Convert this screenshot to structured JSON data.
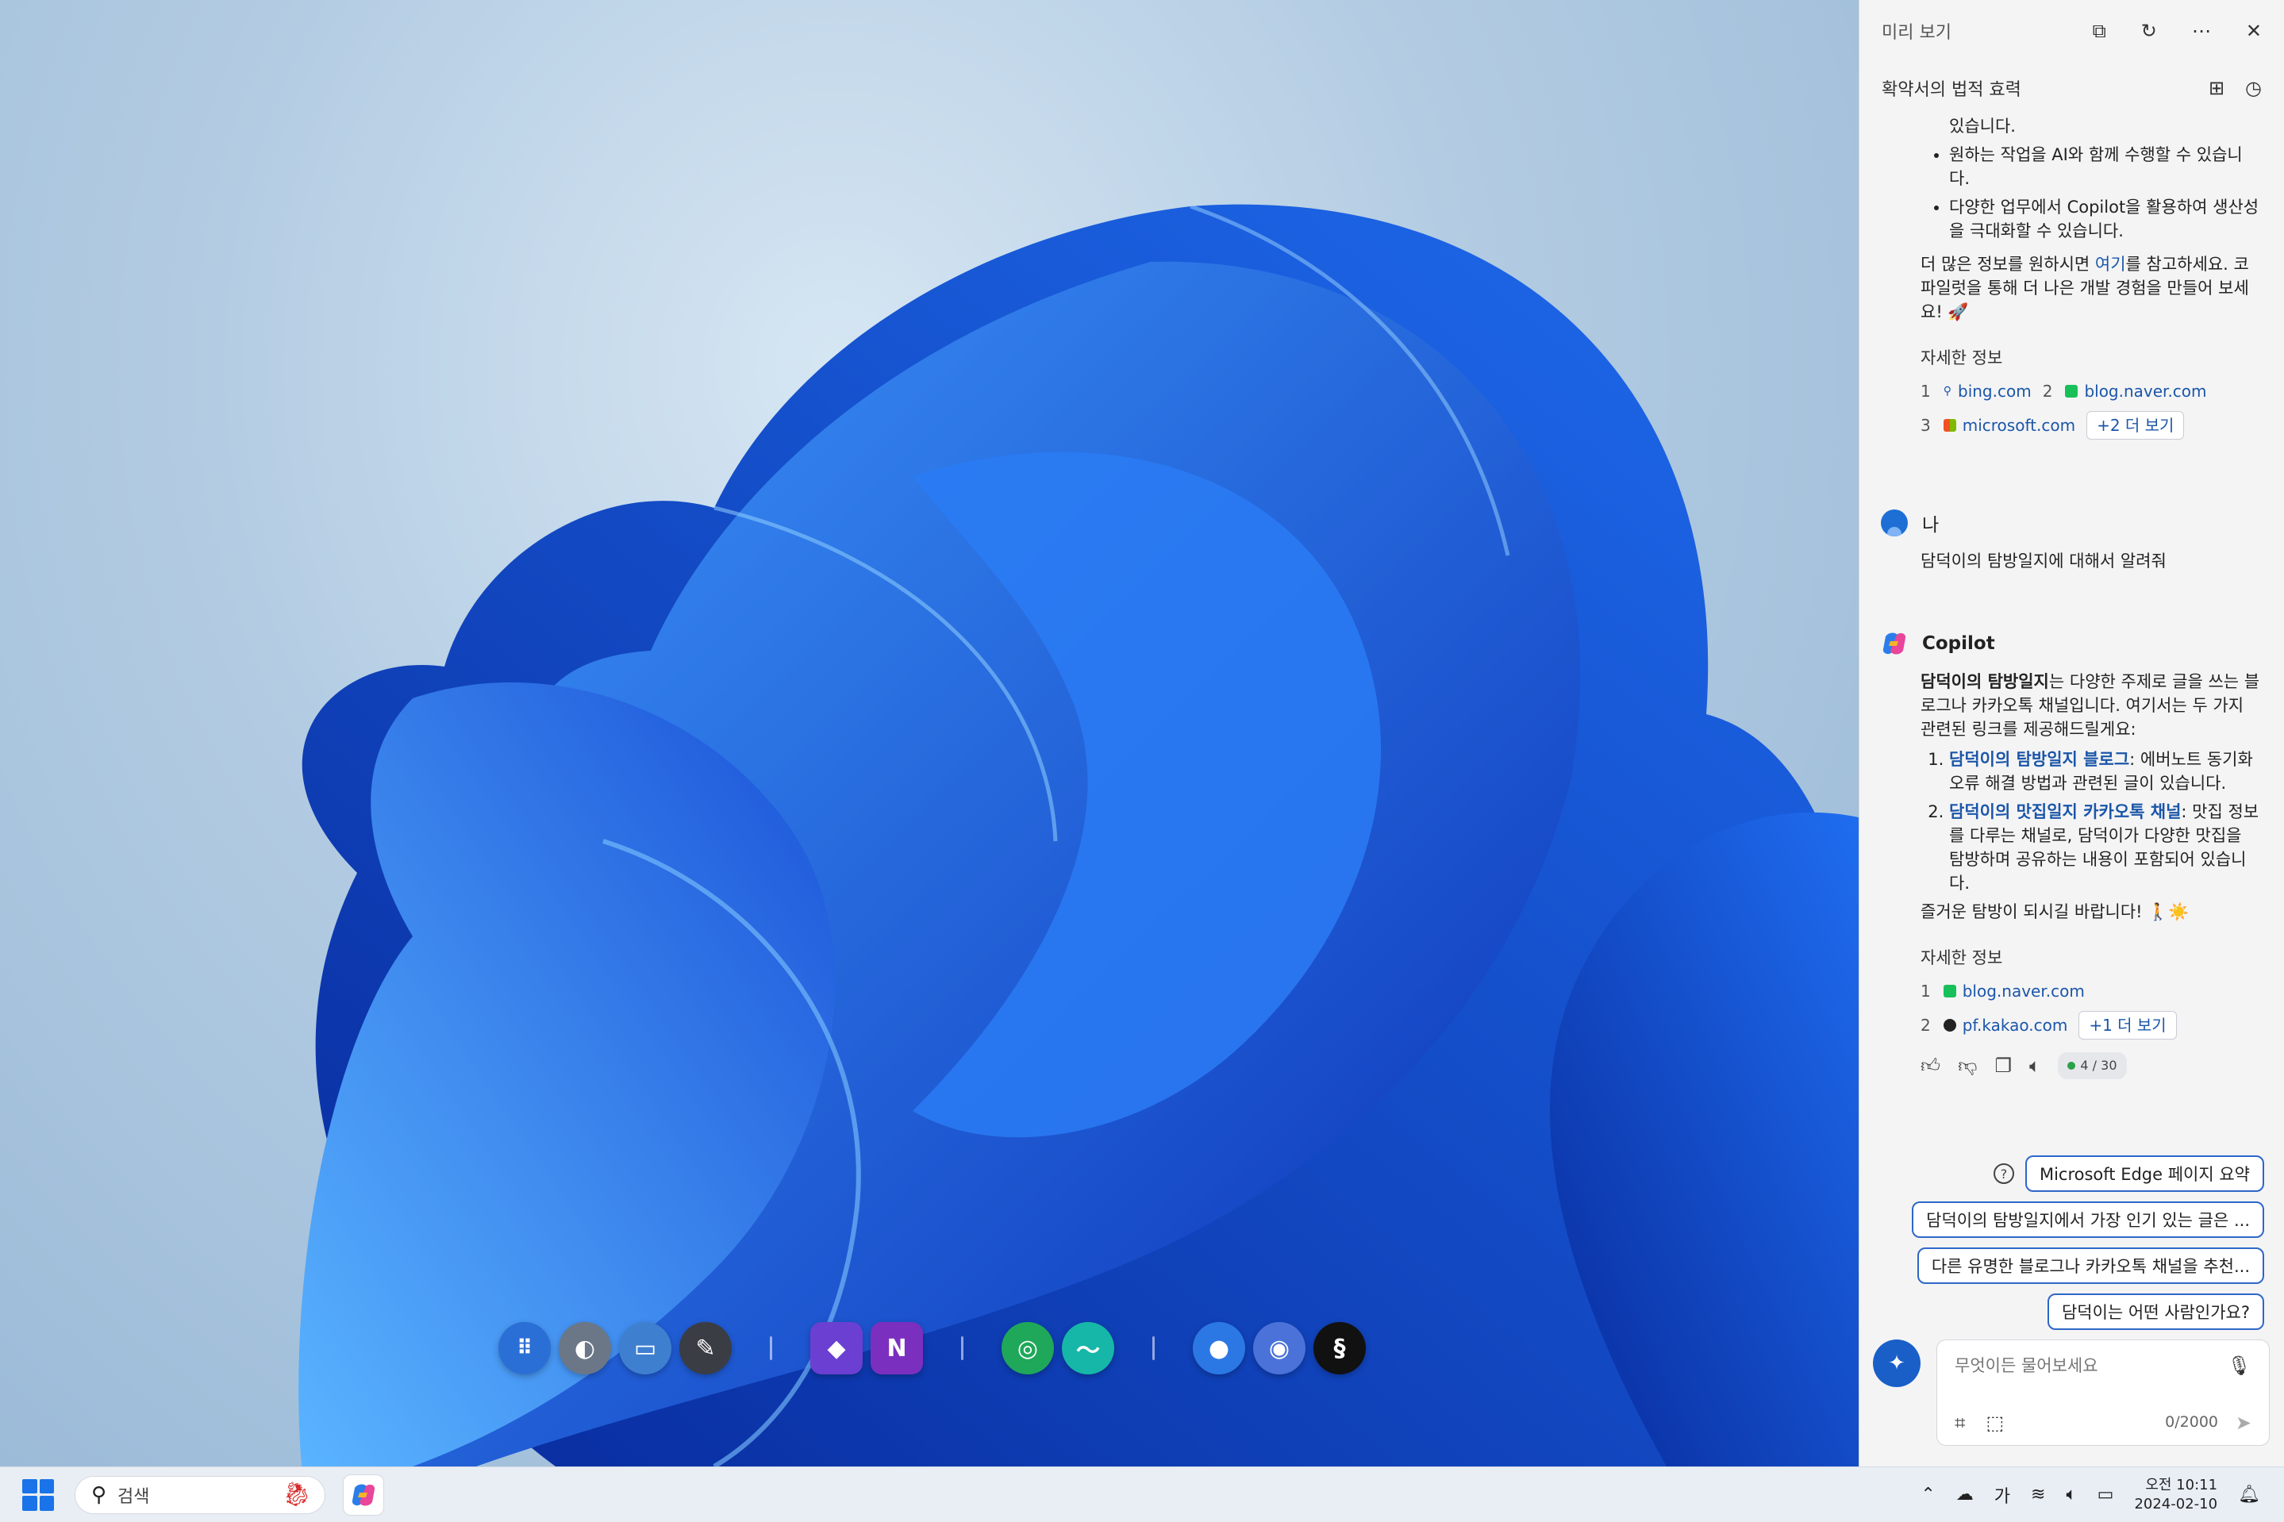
{
  "taskbar": {
    "search_placeholder": "검색",
    "clock_time": "오전 10:11",
    "clock_date": "2024-02-10",
    "ime": "가"
  },
  "pane": {
    "title": "미리 보기",
    "conversation_title": "확약서의 법적 효력"
  },
  "chat": {
    "prev_tail": "있습니다.",
    "prev_bullets": [
      "원하는 작업을 AI와 함께 수행할 수 있습니다.",
      "다양한 업무에서 Copilot을 활용하여 생산성을 극대화할 수 있습니다."
    ],
    "prev_para_a": "더 많은 정보를 원하시면 ",
    "prev_para_link": "여기",
    "prev_para_b": "를 참고하세요. 코파일럿을 통해 더 나은 개발 경험을 만들어 보세요! 🚀",
    "details_label": "자세한 정보",
    "prev_refs": [
      {
        "n": "1",
        "site": "bing.com"
      },
      {
        "n": "2",
        "site": "blog.naver.com"
      },
      {
        "n": "3",
        "site": "microsoft.com"
      }
    ],
    "prev_more": "+2 더 보기",
    "user_name": "나",
    "user_message": "담덕이의 탐방일지에 대해서 알려줘",
    "bot_name": "Copilot",
    "bot_intro_bold": "담덕이의 탐방일지",
    "bot_intro_rest": "는 다양한 주제로 글을 쓰는 블로그나 카카오톡 채널입니다. 여기서는 두 가지 관련된 링크를 제공해드릴게요:",
    "bot_items": [
      {
        "title": "담덕이의 탐방일지 블로그",
        "desc": ": 에버노트 동기화 오류 해결 방법과 관련된 글이 있습니다."
      },
      {
        "title": "담덕이의 맛집일지 카카오톡 채널",
        "desc": ": 맛집 정보를 다루는 채널로, 담덕이가 다양한 맛집을 탐방하며 공유하는 내용이 포함되어 있습니다."
      }
    ],
    "bot_outro": "즐거운 탐방이 되시길 바랍니다! 🚶☀️",
    "bot_refs": [
      {
        "n": "1",
        "site": "blog.naver.com"
      },
      {
        "n": "2",
        "site": "pf.kakao.com"
      }
    ],
    "bot_more": "+1 더 보기",
    "turn_counter": "4 / 30"
  },
  "suggestions": [
    "Microsoft Edge 페이지 요약",
    "담덕이의 탐방일지에서 가장 인기 있는 글은 ...",
    "다른 유명한 블로그나 카카오톡 채널을 추천...",
    "담덕이는 어떤 사람인가요?"
  ],
  "composer": {
    "placeholder": "무엇이든 물어보세요",
    "char_count": "0/2000"
  },
  "colors": {
    "accent": "#1a5fc7",
    "link": "#1b56a8"
  }
}
